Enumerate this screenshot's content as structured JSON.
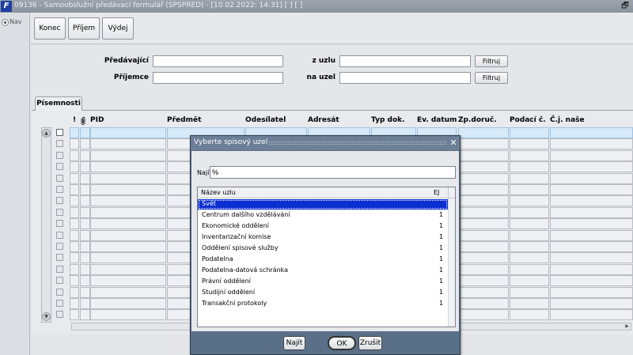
{
  "window": {
    "icon_letter": "F",
    "title": "09136 - Samoobslužní předávací formulář (SPSPRED) - [10.02.2022: 14:31] [ ] [ ]",
    "restore_glyph": "🗗"
  },
  "nav": {
    "label": "Nav"
  },
  "toolbar": {
    "konec": "Konec",
    "prijem": "Příjem",
    "vydej": "Výdej"
  },
  "filter": {
    "predavajici_label": "Předávající",
    "prijemce_label": "Příjemce",
    "z_uzlu_label": "z uzlu",
    "na_uzel_label": "na uzel",
    "filtruj": "Filtruj",
    "predavajici_value": "",
    "prijemce_value": "",
    "z_uzlu_value": "",
    "na_uzel_value": ""
  },
  "tabs": [
    {
      "label": "Písemnosti"
    }
  ],
  "grid": {
    "columns": [
      "!",
      "PID",
      "Předmět",
      "Odesílatel",
      "Adresát",
      "Typ dok.",
      "Ev. datum",
      "Zp.doruč.",
      "Podací č.",
      "Č.j. naše"
    ],
    "attach_icon": "paperclip-icon",
    "row_count": 17
  },
  "dialog": {
    "title": "Vyberte spisový uzel",
    "search_label": "Najít",
    "search_value": "%",
    "list_header": {
      "name": "Název uzlu",
      "ej": "EJ"
    },
    "items": [
      {
        "name": "Svět",
        "ej": "",
        "selected": true
      },
      {
        "name": "Centrum dalšího vzdělávání",
        "ej": "1"
      },
      {
        "name": "Ekonomické oddělení",
        "ej": "1"
      },
      {
        "name": "Inventarizační komise",
        "ej": "1"
      },
      {
        "name": "Oddělení spisové služby",
        "ej": "1"
      },
      {
        "name": "Podatelna",
        "ej": "1"
      },
      {
        "name": "Podatelna-datová schránka",
        "ej": "1"
      },
      {
        "name": "Právní oddělení",
        "ej": "1"
      },
      {
        "name": "Studijní oddělení",
        "ej": "1"
      },
      {
        "name": "Transakční protokoly",
        "ej": "1"
      }
    ],
    "buttons": {
      "najit": "Najít",
      "ok": "OK",
      "zrusit": "Zrušit"
    }
  },
  "colors": {
    "titlebar": "#8a929c",
    "dialog_frame": "#5a6f88",
    "selection": "#0a2ed0",
    "grid_first_row": "#d7eaf8"
  }
}
